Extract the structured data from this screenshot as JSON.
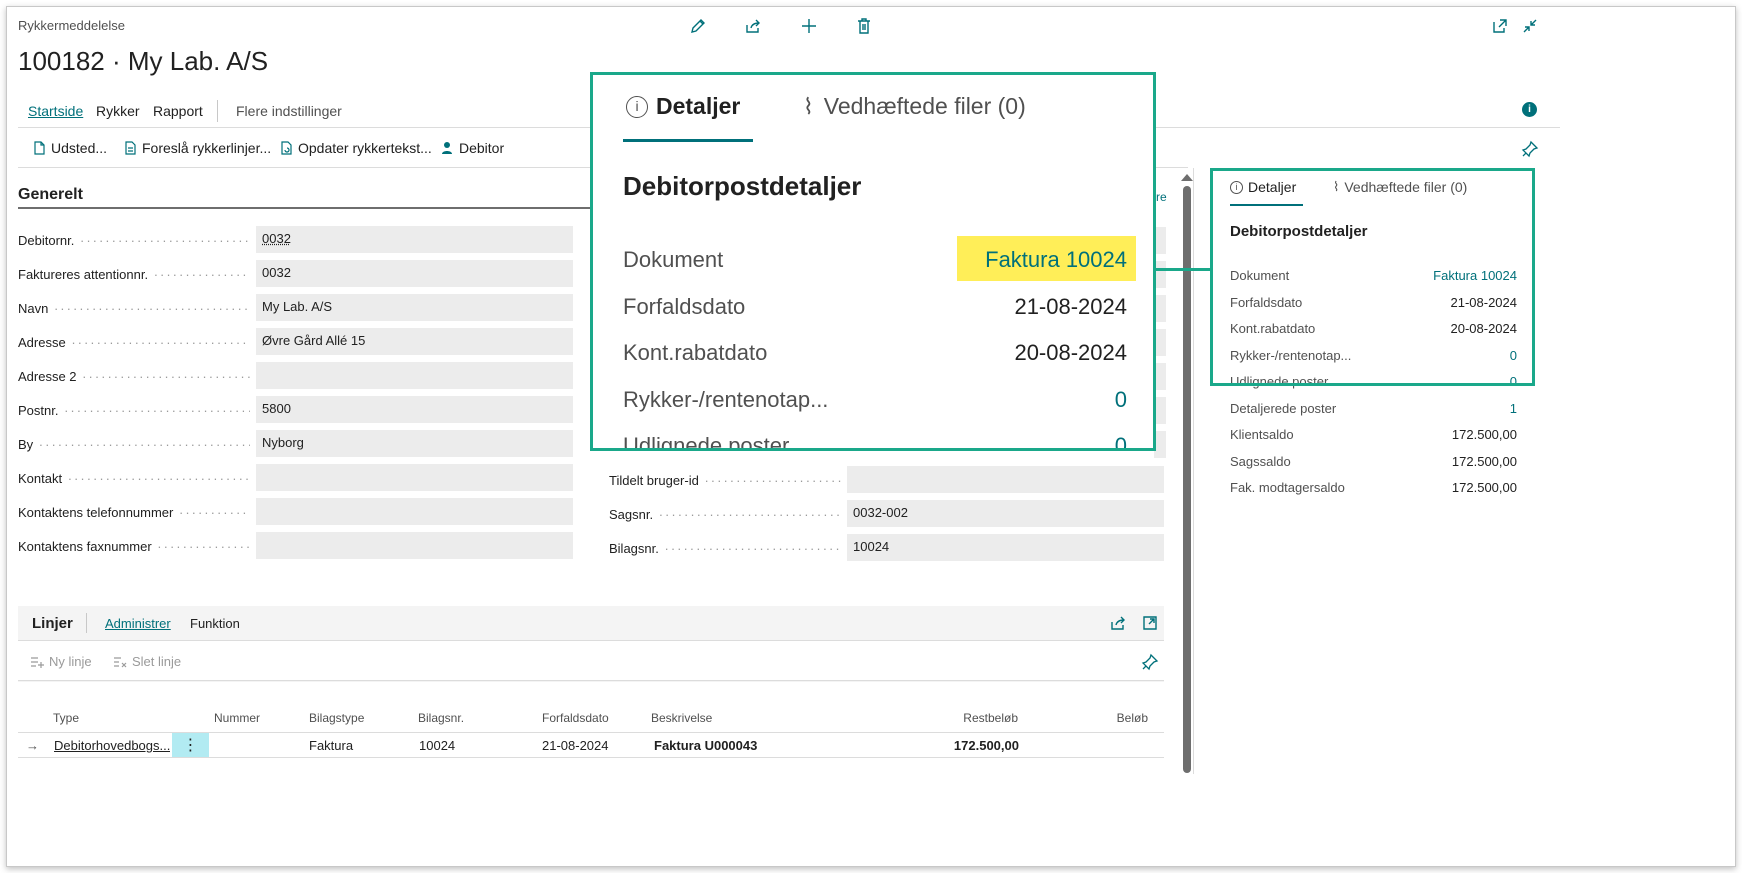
{
  "page": {
    "caption": "Rykkermeddelelse",
    "title": "100182 · My Lab. A/S"
  },
  "header_icons": [
    "edit-icon",
    "share-icon",
    "new-icon",
    "delete-icon"
  ],
  "tabs": [
    "Startside",
    "Rykker",
    "Rapport",
    "Flere indstillinger"
  ],
  "actions": [
    "Udsted...",
    "Foreslå rykkerlinjer...",
    "Opdater rykkertekst...",
    "Debitor"
  ],
  "general": {
    "title": "Generelt",
    "fields_left": [
      {
        "label": "Debitornr.",
        "value": "0032"
      },
      {
        "label": "Faktureres attentionnr.",
        "value": "0032"
      },
      {
        "label": "Navn",
        "value": "My Lab. A/S"
      },
      {
        "label": "Adresse",
        "value": "Øvre Gård Allé 15"
      },
      {
        "label": "Adresse 2",
        "value": ""
      },
      {
        "label": "Postnr.",
        "value": "5800"
      },
      {
        "label": "By",
        "value": "Nyborg"
      },
      {
        "label": "Kontakt",
        "value": ""
      },
      {
        "label": "Kontaktens telefonnummer",
        "value": ""
      },
      {
        "label": "Kontaktens faxnummer",
        "value": ""
      }
    ],
    "fields_right": [
      {
        "label": "Tildelt bruger-id",
        "value": ""
      },
      {
        "label": "Sagsnr.",
        "value": "0032-002"
      },
      {
        "label": "Bilagsnr.",
        "value": "10024"
      }
    ],
    "partial_right_text": "re"
  },
  "lines": {
    "title": "Linjer",
    "tabs": [
      "Administrer",
      "Funktion"
    ],
    "actions": [
      "Ny linje",
      "Slet linje"
    ],
    "columns": [
      "Type",
      "Nummer",
      "Bilagstype",
      "Bilagsnr.",
      "Forfaldsdato",
      "Beskrivelse",
      "Restbeløb",
      "Beløb"
    ],
    "rows": [
      {
        "type": "Debitorhovedbogs...",
        "nummer": "",
        "bilagstype": "Faktura",
        "bilagsnr": "10024",
        "forfaldsdato": "21-08-2024",
        "beskrivelse": "Faktura U000043",
        "restbelob": "172.500,00",
        "belob": ""
      }
    ]
  },
  "factbox": {
    "tab_details": "Detaljer",
    "tab_attachments": "Vedhæftede filer (0)",
    "title": "Debitorpostdetaljer",
    "rows": [
      {
        "label": "Dokument",
        "value": "Faktura 10024",
        "link": true
      },
      {
        "label": "Forfaldsdato",
        "value": "21-08-2024",
        "link": false
      },
      {
        "label": "Kont.rabatdato",
        "value": "20-08-2024",
        "link": false
      },
      {
        "label": "Rykker-/rentenotap...",
        "value": "0",
        "link": true
      },
      {
        "label": "Udlignede poster",
        "value": "0",
        "link": true
      },
      {
        "label": "Detaljerede poster",
        "value": "1",
        "link": true
      },
      {
        "label": "Klientsaldo",
        "value": "172.500,00",
        "link": false
      },
      {
        "label": "Sagssaldo",
        "value": "172.500,00",
        "link": false
      },
      {
        "label": "Fak. modtagersaldo",
        "value": "172.500,00",
        "link": false
      }
    ]
  },
  "colors": {
    "accent": "#00707a",
    "callout_border": "#1aa88a",
    "highlight": "#ffee58"
  }
}
